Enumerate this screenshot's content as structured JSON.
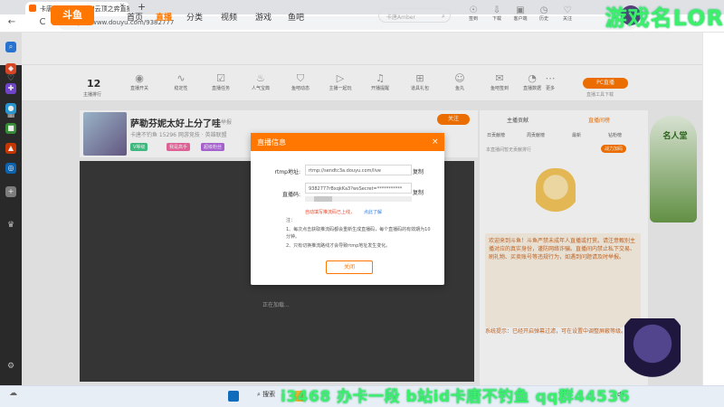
{
  "browser": {
    "tab_title": "卡唐不钓鱼直播_lol云顶之弈直播",
    "tab_close": "×",
    "new_tab": "+",
    "url": "https://www.douyu.com/9382777",
    "back": "←",
    "reload": "C",
    "menu": "···"
  },
  "overlay": {
    "game_name": "游戏名LOR",
    "bottom_text": "i3468 办卡一段 b站id卡唐不钓鱼 qq群44536"
  },
  "site_header": {
    "logo": "斗鱼",
    "nav": [
      "首页",
      "直播",
      "分类",
      "视频",
      "游戏",
      "鱼吧"
    ],
    "nav_active_index": 1,
    "search_placeholder": "卡唐Amber",
    "icons": [
      "签到",
      "下载",
      "客户端",
      "历史",
      "关注"
    ]
  },
  "toolbar": {
    "rank_number": "12",
    "rank_label": "主播排行",
    "items": [
      "直播开关",
      "稳定性",
      "直播任务",
      "人气宝典",
      "鱼吧动态",
      "主播一起玩",
      "开播提醒",
      "道具礼包",
      "鱼丸",
      "鱼吧签到",
      "直播数据",
      "更多"
    ],
    "pc_live_button": "PC直播",
    "pc_live_sub": "直播工具下载"
  },
  "stream": {
    "title": "萨勒芬妮太好上分了哇",
    "report": "举报",
    "meta": "卡唐不钓鱼  15296  网游竞技 · 英雄联盟",
    "tags": [
      "V等级",
      "我是高手",
      "超级粉丝"
    ],
    "follow_button": "关注",
    "loading_text": "正在加载..."
  },
  "right_panel": {
    "tabs": [
      "主播贡献",
      "直播间榜"
    ],
    "subtabs": [
      "日贡献榜",
      "周贡献榜",
      "最新",
      "钻粉榜"
    ],
    "power_button": "战力加码",
    "notice": "本直播间暂无贡献排行",
    "chat_text": "欢迎来到斗鱼！斗鱼严禁未成年人直播或打赏。请注意甄别主播对应的真实身份，谨防网络诈骗。直播间内禁止私下交易、刷礼物、买卖账号等违规行为，如遇到问题请及时举报。",
    "system_msg": "系统提示：已经开启弹幕过滤，可在设置中调整屏蔽等级。",
    "side_promo": "名人堂"
  },
  "modal": {
    "title": "直播信息",
    "close_icon": "×",
    "rtmp_label": "rtmp地址:",
    "rtmp_value": "rtmp://sendtc3a.douyu.com/live",
    "code_label": "直播码:",
    "code_value": "9382777rBxqkKa3?wsSecret=***********",
    "copy_label": "复制",
    "auto_fill": "自动填写推流码已上线，",
    "learn_more": "点此了解",
    "note_title": "注：",
    "note_1": "1、每次点击获取推流码都会重新生成直播码，每个直播码的有效期为10分钟。",
    "note_2": "2、只有切换推流路线才会导致rtmp地址发生变化。",
    "close_button": "关闭"
  },
  "taskbar": {
    "search": "搜索",
    "ime": "中"
  },
  "colors": {
    "accent": "#ff7700",
    "overlay_green": "#3cf06c",
    "link_blue": "#2b7de1",
    "warn_red": "#e84a28"
  }
}
